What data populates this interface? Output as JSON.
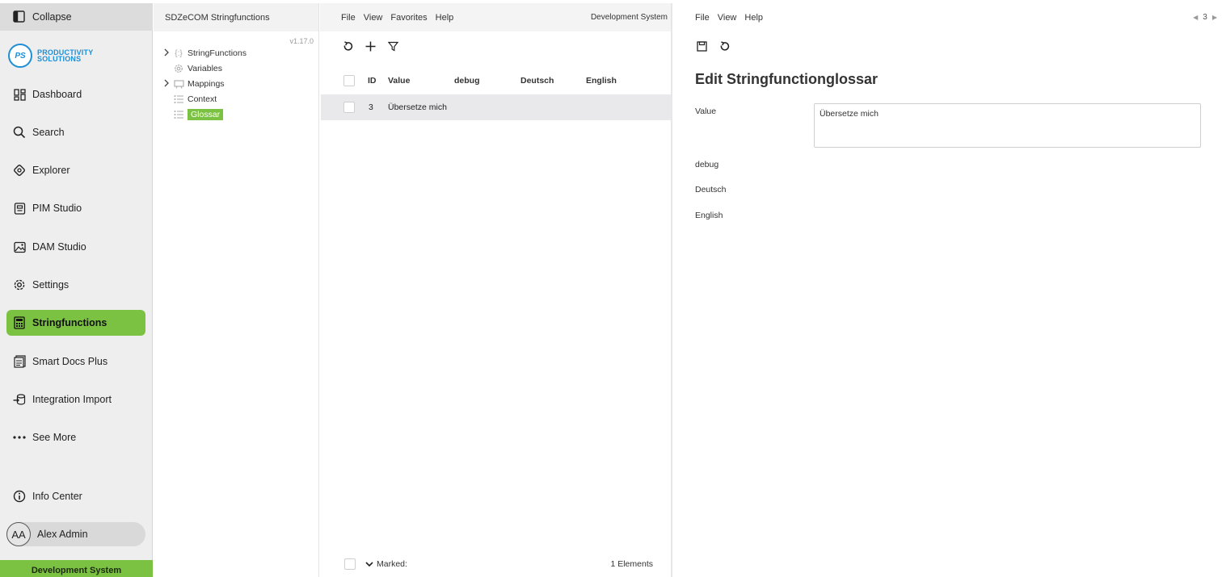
{
  "sidebar": {
    "collapse_label": "Collapse",
    "logo": {
      "mark": "PS",
      "line1": "PRODUCTIVITY",
      "line2": "SOLUTIONS"
    },
    "items": [
      {
        "label": "Dashboard",
        "icon": "dashboard-icon"
      },
      {
        "label": "Search",
        "icon": "search-icon"
      },
      {
        "label": "Explorer",
        "icon": "explorer-icon"
      },
      {
        "label": "PIM Studio",
        "icon": "pim-icon"
      },
      {
        "label": "DAM Studio",
        "icon": "image-icon"
      },
      {
        "label": "Settings",
        "icon": "gear-icon"
      },
      {
        "label": "Stringfunctions",
        "icon": "calculator-icon",
        "active": true
      },
      {
        "label": "Smart Docs Plus",
        "icon": "document-icon"
      },
      {
        "label": "Integration Import",
        "icon": "import-icon"
      },
      {
        "label": "See More",
        "icon": "more-icon"
      }
    ],
    "info_center": "Info Center",
    "user": {
      "initials": "AA",
      "name": "Alex Admin"
    },
    "environment": "Development System",
    "accent_color": "#7cc242"
  },
  "tree": {
    "title": "SDZeCOM Stringfunctions",
    "version": "v1.17.0",
    "nodes": [
      {
        "label": "StringFunctions",
        "expandable": true
      },
      {
        "label": "Variables",
        "expandable": false
      },
      {
        "label": "Mappings",
        "expandable": true
      },
      {
        "label": "Context",
        "expandable": false
      },
      {
        "label": "Glossar",
        "expandable": false,
        "selected": true
      }
    ]
  },
  "list": {
    "menu": [
      "File",
      "View",
      "Favorites",
      "Help"
    ],
    "environment": "Development System",
    "columns": [
      "ID",
      "Value",
      "debug",
      "Deutsch",
      "English"
    ],
    "rows": [
      {
        "id": "3",
        "value": "Übersetze mich",
        "debug": "",
        "deutsch": "",
        "english": ""
      }
    ],
    "footer": {
      "marked_label": "Marked:",
      "count_label": "1 Elements"
    }
  },
  "detail": {
    "menu": [
      "File",
      "View",
      "Help"
    ],
    "pager": "3",
    "title": "Edit Stringfunctionglossar",
    "fields": {
      "value_label": "Value",
      "value": "Übersetze mich",
      "debug_label": "debug",
      "deutsch_label": "Deutsch",
      "english_label": "English"
    }
  }
}
